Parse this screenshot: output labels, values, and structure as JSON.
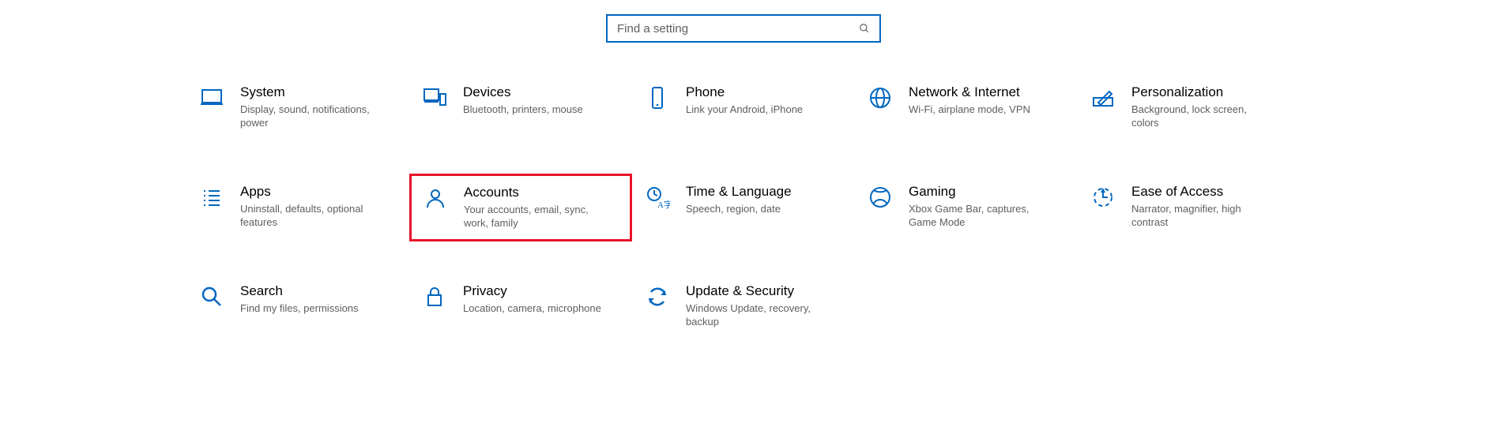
{
  "search": {
    "placeholder": "Find a setting"
  },
  "highlight_id": "accounts",
  "categories": [
    {
      "id": "system",
      "icon": "laptop",
      "title": "System",
      "desc": "Display, sound, notifications, power"
    },
    {
      "id": "devices",
      "icon": "devices",
      "title": "Devices",
      "desc": "Bluetooth, printers, mouse"
    },
    {
      "id": "phone",
      "icon": "phone",
      "title": "Phone",
      "desc": "Link your Android, iPhone"
    },
    {
      "id": "network",
      "icon": "globe",
      "title": "Network & Internet",
      "desc": "Wi-Fi, airplane mode, VPN"
    },
    {
      "id": "personalization",
      "icon": "pen",
      "title": "Personalization",
      "desc": "Background, lock screen, colors"
    },
    {
      "id": "apps",
      "icon": "list",
      "title": "Apps",
      "desc": "Uninstall, defaults, optional features"
    },
    {
      "id": "accounts",
      "icon": "person",
      "title": "Accounts",
      "desc": "Your accounts, email, sync, work, family"
    },
    {
      "id": "time",
      "icon": "time-lang",
      "title": "Time & Language",
      "desc": "Speech, region, date"
    },
    {
      "id": "gaming",
      "icon": "xbox",
      "title": "Gaming",
      "desc": "Xbox Game Bar, captures, Game Mode"
    },
    {
      "id": "ease",
      "icon": "ease",
      "title": "Ease of Access",
      "desc": "Narrator, magnifier, high contrast"
    },
    {
      "id": "search",
      "icon": "search",
      "title": "Search",
      "desc": "Find my files, permissions"
    },
    {
      "id": "privacy",
      "icon": "lock",
      "title": "Privacy",
      "desc": "Location, camera, microphone"
    },
    {
      "id": "update",
      "icon": "sync",
      "title": "Update & Security",
      "desc": "Windows Update, recovery, backup"
    }
  ]
}
